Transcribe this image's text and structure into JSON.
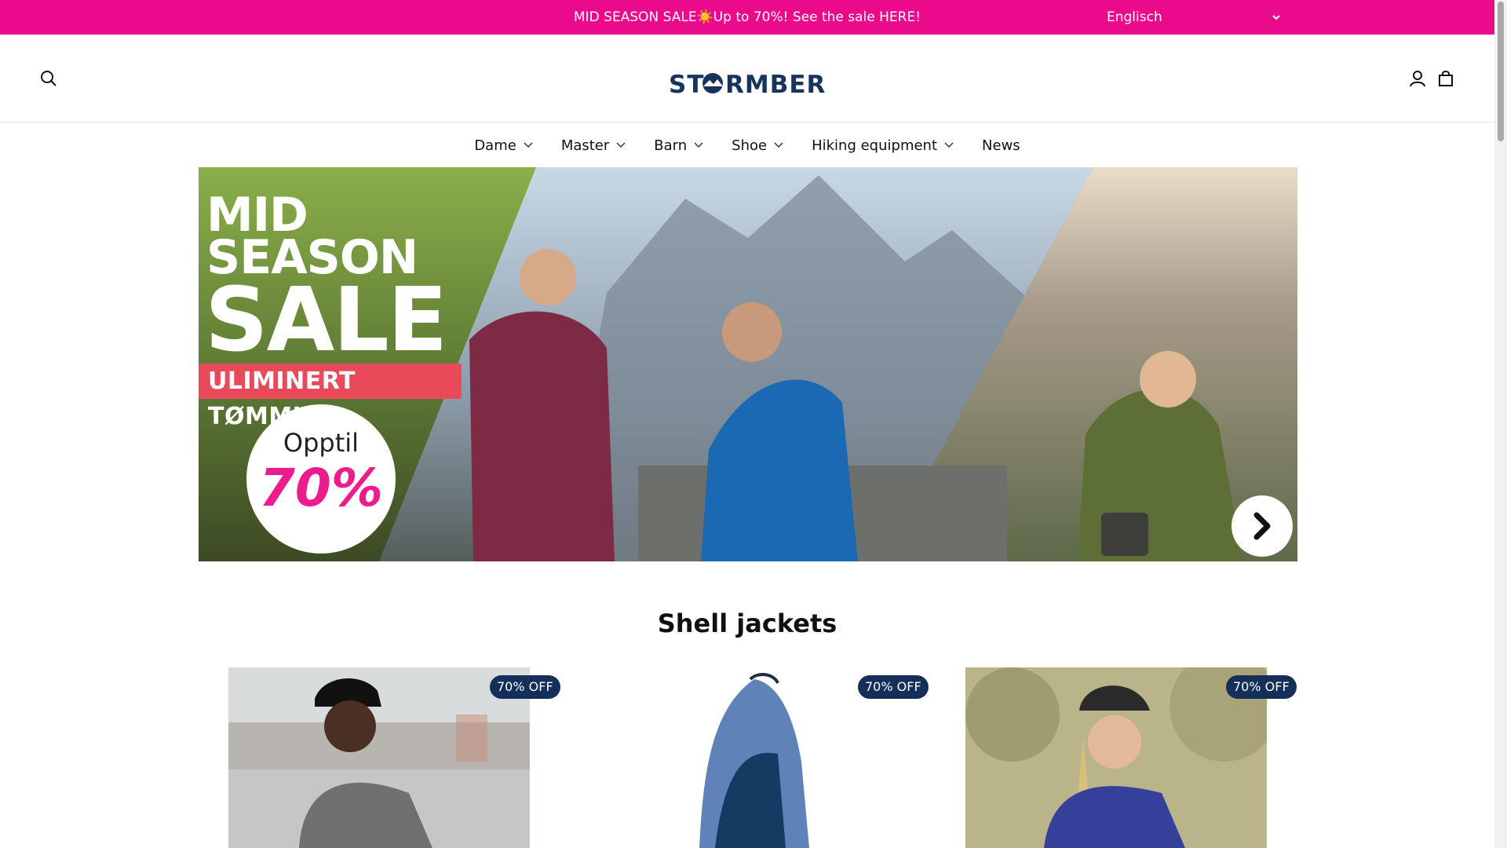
{
  "announcement": {
    "text": "MID SEASON SALE☀️Up to 70%! See the sale HERE!",
    "language": "Englisch"
  },
  "header": {
    "logo_text": "STORMBERG",
    "icons": [
      "search-icon",
      "account-icon",
      "cart-icon"
    ]
  },
  "nav": {
    "items": [
      {
        "label": "Dame",
        "has_dropdown": true
      },
      {
        "label": "Master",
        "has_dropdown": true
      },
      {
        "label": "Barn",
        "has_dropdown": true
      },
      {
        "label": "Shoe",
        "has_dropdown": true
      },
      {
        "label": "Hiking equipment",
        "has_dropdown": true
      },
      {
        "label": "News",
        "has_dropdown": false
      }
    ]
  },
  "hero": {
    "line1": "MID",
    "line2": "SEASON",
    "line3": "SALE",
    "tag": "ULIMINERT TØMMING",
    "upto": "Opptil",
    "percent": "70%"
  },
  "section": {
    "title": "Shell jackets",
    "products": [
      {
        "badge": "70% OFF"
      },
      {
        "badge": "70% OFF"
      },
      {
        "badge": "70% OFF"
      }
    ]
  },
  "colors": {
    "announcement_bg": "#ec0a8c",
    "badge_bg": "#142f5a",
    "hero_tag_bg": "#e84a5a",
    "hero_percent": "#ec1b8e"
  }
}
